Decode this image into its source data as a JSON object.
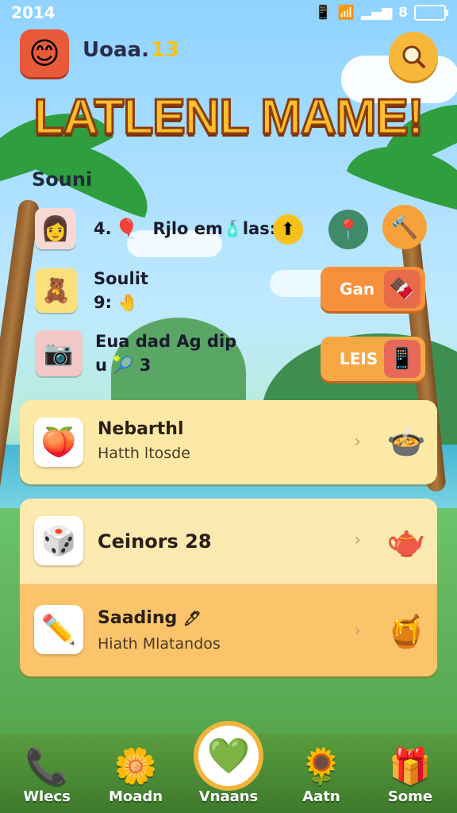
{
  "status_bar": {
    "time": "2014",
    "indicator": "8"
  },
  "header": {
    "player_name": "Uoaa.",
    "player_level": "13",
    "title": "LATLENL MAME!"
  },
  "section_label": "Souni",
  "rows": [
    {
      "text_a": "4.",
      "text_b": "Rjlo em",
      "text_c": "las:"
    },
    {
      "title": "Soulit",
      "value": "9:"
    },
    {
      "title": "Eua dad Ag dip",
      "value_a": "u",
      "value_b": "3"
    }
  ],
  "side_buttons": [
    {
      "label": "Gan"
    },
    {
      "label": "LEIS"
    }
  ],
  "cards": [
    {
      "title": "Nebarthl",
      "subtitle": "Hatth ltosde"
    },
    {
      "title": "Ceinors 28"
    },
    {
      "title": "Saading",
      "subtitle": "Hiath Mlatandos"
    }
  ],
  "nav": [
    {
      "label": "Wlecs"
    },
    {
      "label": "Moadn"
    },
    {
      "label": "Vnaans"
    },
    {
      "label": "Aatn"
    },
    {
      "label": "Some"
    }
  ],
  "colors": {
    "accent": "#f6903a",
    "title_fill": "#ffbf2a",
    "card_bg": "#fde9a6",
    "nav_bg": "#4a8c35"
  }
}
